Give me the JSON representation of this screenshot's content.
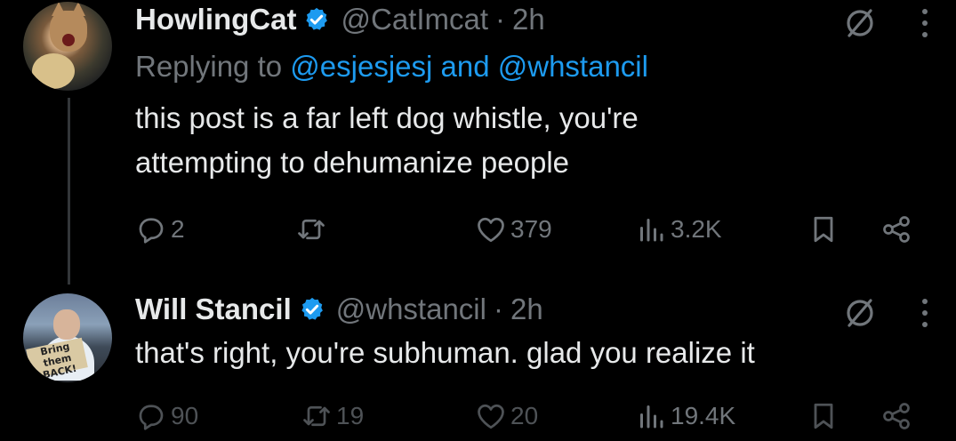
{
  "tweets": [
    {
      "display_name": "HowlingCat",
      "handle": "@CatImcat",
      "dot": "·",
      "time": "2h",
      "replying_prefix": "Replying to",
      "reply_user_1": "@esjesjesj",
      "reply_and": "and",
      "reply_user_2": "@whstancil",
      "text_line_1": "this post is a far left dog whistle, you're",
      "text_line_2": "attempting to dehumanize people",
      "replies": "2",
      "reposts": "",
      "likes": "379",
      "views": "3.2K"
    },
    {
      "display_name": "Will Stancil",
      "handle": "@whstancil",
      "dot": "·",
      "time": "2h",
      "text_line_1": "that's right, you're subhuman. glad you realize it",
      "avatar_sign_text": "Bring them BACK!",
      "replies": "90",
      "reposts": "19",
      "likes": "20",
      "views": "19.4K"
    }
  ],
  "icons": {
    "verified": "verified-badge-icon",
    "grok": "grok-icon",
    "more": "more-icon",
    "reply": "reply-icon",
    "repost": "repost-icon",
    "like": "like-icon",
    "views": "views-icon",
    "bookmark": "bookmark-icon",
    "share": "share-icon"
  },
  "colors": {
    "background": "#000000",
    "text": "#e7e9ea",
    "muted": "#71767b",
    "link": "#1d9bf0",
    "verified": "#1d9bf0"
  }
}
